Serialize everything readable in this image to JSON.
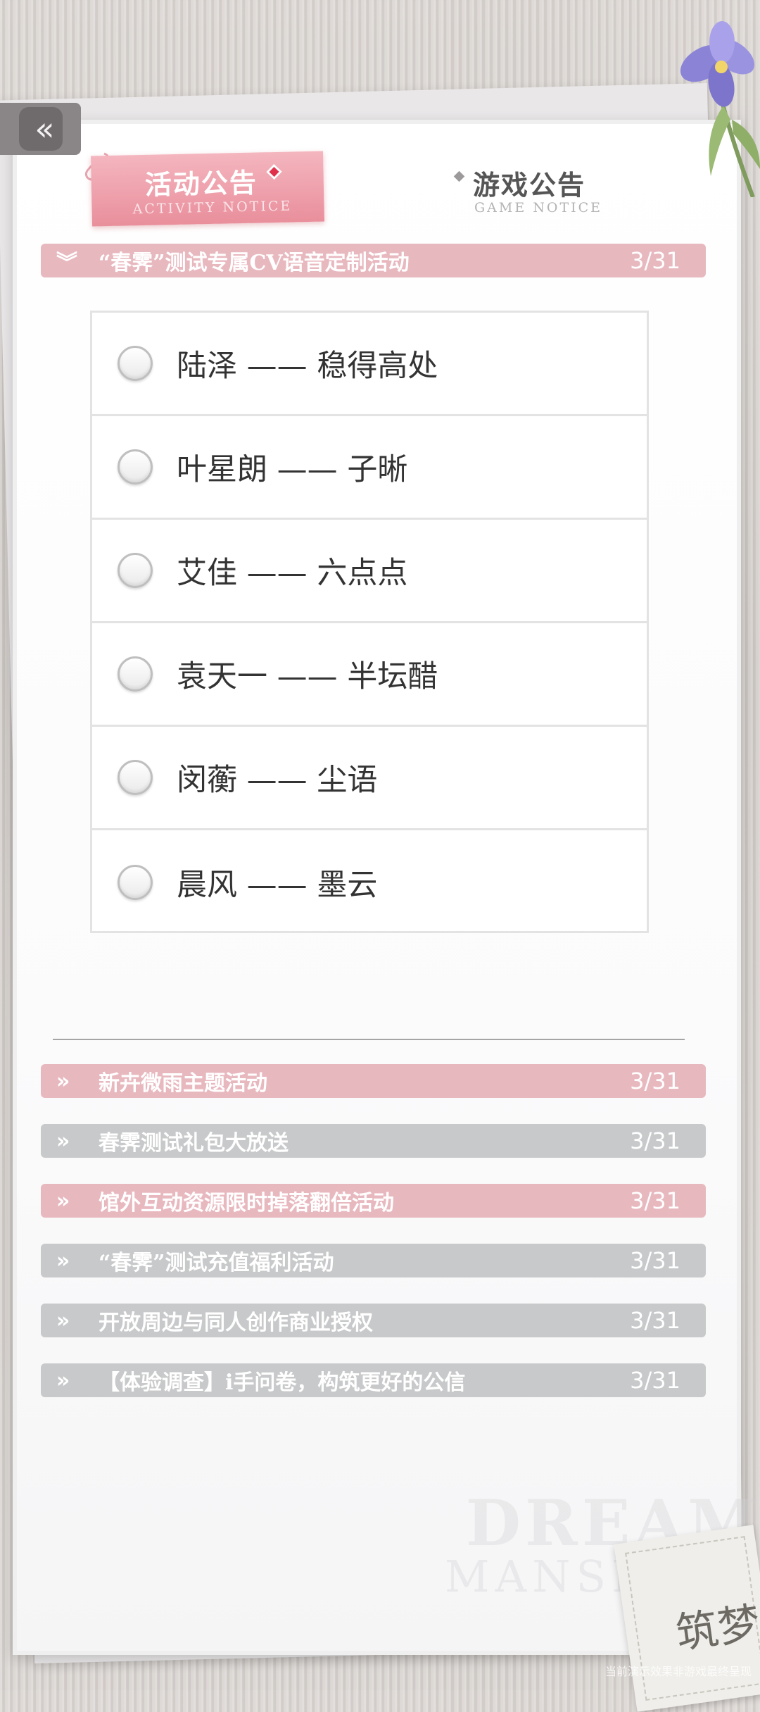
{
  "tabs": {
    "active": {
      "title": "活动公告",
      "subtitle": "ACTIVITY NOTICE"
    },
    "inactive": {
      "title": "游戏公告",
      "subtitle": "GAME NOTICE"
    }
  },
  "expanded_notice": {
    "title": "“春霁”测试专属CV语音定制活动",
    "date": "3/31",
    "options": [
      {
        "label": "陆泽 —— 稳得高处"
      },
      {
        "label": "叶星朗 —— 子晰"
      },
      {
        "label": "艾佳 —— 六点点"
      },
      {
        "label": "袁天一 —— 半坛醋"
      },
      {
        "label": "闵蘅 —— 尘语"
      },
      {
        "label": "晨风 —— 墨云"
      }
    ]
  },
  "notices": [
    {
      "title": "新卉微雨主题活动",
      "date": "3/31",
      "style": "pink"
    },
    {
      "title": "春霁测试礼包大放送",
      "date": "3/31",
      "style": "gray"
    },
    {
      "title": "馆外互动资源限时掉落翻倍活动",
      "date": "3/31",
      "style": "pink"
    },
    {
      "title": "“春霁”测试充值福利活动",
      "date": "3/31",
      "style": "gray"
    },
    {
      "title": "开放周边与同人创作商业授权",
      "date": "3/31",
      "style": "gray"
    },
    {
      "title": "【体验调查】i手问卷，构筑更好的公信",
      "date": "3/31",
      "style": "gray"
    }
  ],
  "watermark": {
    "line1": "DREAM",
    "line2": "MANSION",
    "calligraphy": "筑梦"
  },
  "footnote": "当前演示效果非游戏最终呈现",
  "icons": {
    "back": "double-chevron-left-icon",
    "expand": "double-chevron-down-icon",
    "arrow": "double-chevron-right-icon"
  },
  "colors": {
    "accent_pink": "#e8b8bf",
    "muted_gray": "#c8c9ca",
    "tab_pink": "#ee9fab"
  }
}
